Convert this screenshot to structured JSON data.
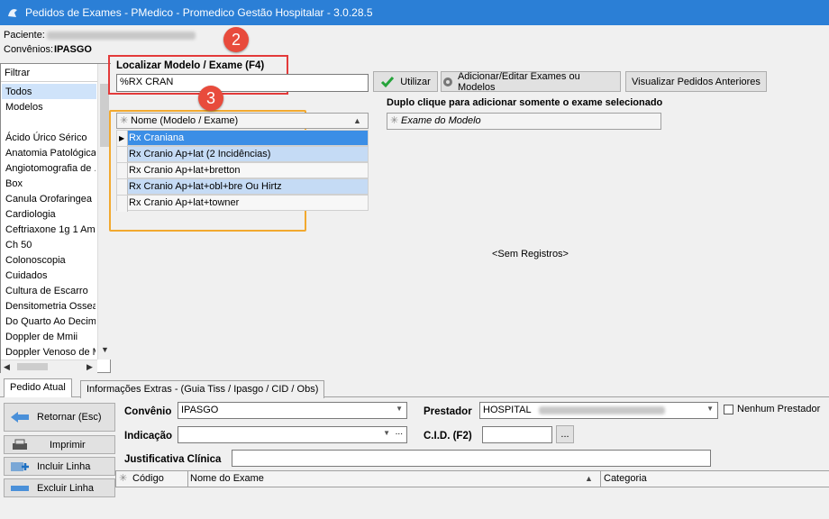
{
  "window": {
    "title": "Pedidos de Exames - PMedico - Promedico Gestão Hospitalar - 3.0.28.5"
  },
  "patient": {
    "label": "Paciente:",
    "convenios_label": "Convênios:",
    "convenios_value": "IPASGO"
  },
  "filter": {
    "header": "Filtrar",
    "items": [
      "Todos",
      "Modelos",
      "",
      "Ácido Úrico Sérico",
      "Anatomia Patológica",
      "Angiotomografia de ...",
      "Box",
      "Canula Orofaringea ...",
      "Cardiologia",
      "Ceftriaxone 1g 1 Am...",
      "Ch 50",
      "Colonoscopia",
      "Cuidados",
      "Cultura de Escarro",
      "Densitometria Ossea",
      "Do Quarto Ao Decim...",
      "Doppler de Mmii",
      "Doppler Venoso de M..."
    ]
  },
  "search": {
    "label": "Localizar Modelo / Exame (F4)",
    "value": "%RX CRAN",
    "utilizar": "Utilizar",
    "add_edit": "Adicionar/Editar Exames ou Modelos",
    "view_prev": "Visualizar Pedidos Anteriores"
  },
  "badges": {
    "b2": "2",
    "b3": "3"
  },
  "models_grid": {
    "header": "Nome (Modelo / Exame)",
    "rows": [
      "Rx Craniana",
      "Rx Cranio Ap+lat (2 Incidências)",
      "Rx Cranio Ap+lat+bretton",
      "Rx Cranio Ap+lat+obl+bre Ou Hirtz",
      "Rx Cranio Ap+lat+towner"
    ]
  },
  "right_panel": {
    "title": "Duplo clique para adicionar somente o exame selecionado",
    "header": "Exame do Modelo",
    "empty": "<Sem Registros>"
  },
  "tabs": {
    "current": "Pedido Atual",
    "extra": "Informações Extras -  (Guia Tiss / Ipasgo / CID / Obs)"
  },
  "actions": {
    "retornar": "Retornar (Esc)",
    "imprimir": "Imprimir",
    "incluir": "Incluir Linha",
    "excluir": "Excluir Linha"
  },
  "form": {
    "convenio_label": "Convênio",
    "convenio_value": "IPASGO",
    "prestador_label": "Prestador",
    "prestador_value": "HOSPITAL",
    "nenhum_prestador": "Nenhum Prestador",
    "indicacao_label": "Indicação",
    "indicacao_value": "",
    "cid_label": "C.I.D. (F2)",
    "cid_value": "",
    "justificativa_label": "Justificativa Clínica",
    "justificativa_value": "",
    "ellipsis": "...",
    "cid_ellipsis": "..."
  },
  "exam_table": {
    "columns": [
      "Código",
      "Nome do Exame",
      "Categoria"
    ]
  },
  "colors": {
    "titlebar": "#2b7fd6",
    "selected_row": "#3b8ee6",
    "alt_row": "#c5dbf5",
    "highlight_red": "#e33a3a",
    "highlight_orange": "#f2a92f"
  }
}
